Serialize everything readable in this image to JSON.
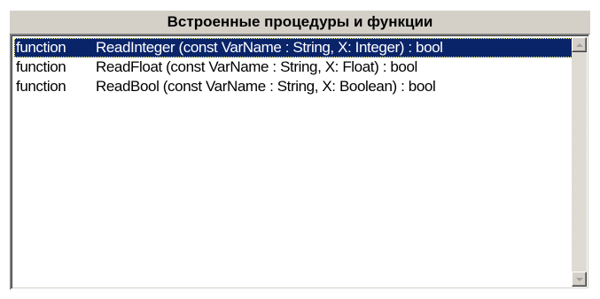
{
  "panel": {
    "title": "Встроенные процедуры и функции"
  },
  "list": {
    "items": [
      {
        "keyword": "function",
        "signature": "ReadInteger (const VarName : String, X: Integer) : bool",
        "selected": true
      },
      {
        "keyword": "function",
        "signature": "ReadFloat (const VarName : String, X: Float)  : bool",
        "selected": false
      },
      {
        "keyword": "function",
        "signature": "ReadBool (const VarName : String, X: Boolean)  : bool",
        "selected": false
      }
    ]
  },
  "scrollbar": {
    "up_icon": "arrow-up-icon",
    "down_icon": "arrow-down-icon"
  },
  "colors": {
    "selection_bg": "#0a246a",
    "selection_fg": "#ffffff",
    "header_bg": "#d4d0c8"
  }
}
